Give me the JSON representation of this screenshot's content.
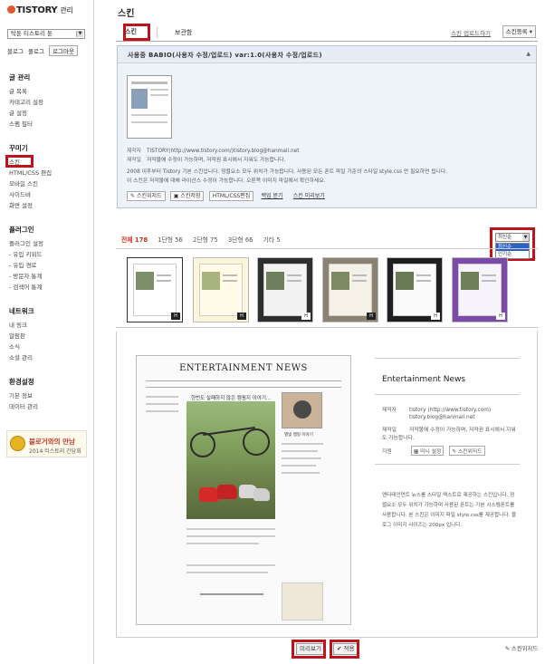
{
  "app": {
    "logo": "TISTORY",
    "admin": "관리"
  },
  "sidebar": {
    "blog_select": "탁툰 티스토리 툰",
    "top_links": [
      "블로그",
      "플로그",
      "로그아웃"
    ],
    "sections": [
      {
        "title": "글 관리",
        "items": [
          "글 목록",
          "카테고리 설정",
          "글 설정",
          "스팸 필터"
        ]
      },
      {
        "title": "꾸미기",
        "items": [
          "스킨",
          "HTML/CSS 편집",
          "모바일 스킨",
          "사이드바",
          "화면 설정"
        ]
      },
      {
        "title": "플러그인",
        "items": [
          "플러그인 설정",
          "- 유입 키워드",
          "- 유입 경로",
          "- 방문자 통계",
          "- 검색어 통계"
        ]
      },
      {
        "title": "네트워크",
        "items": [
          "내 링크",
          "알림판",
          "소식",
          "쇼셜 관리"
        ]
      },
      {
        "title": "환경설정",
        "items": [
          "기본 정보",
          "데이터 관리"
        ]
      }
    ],
    "banner": {
      "line1": "블로거와의 만남",
      "line2": "2014 티스토리 간담회"
    }
  },
  "main": {
    "title": "스킨",
    "tabs": {
      "active": "스킨",
      "other": "보관함",
      "right_link": "스킨 업로드하기",
      "register": "스킨등록"
    },
    "info": {
      "heading": "사용중  BABIO(사용자 수정/업로드) var:1.0(사용자 수정/업로드)",
      "rows": [
        {
          "label": "제작자",
          "value": "TISTORY(http://www.tistory.com/)tistory.blog@hanmail.net"
        },
        {
          "label": "제작일",
          "value": "저작물에 수정이 가능하며, 저작권 표시에서 지워도 가능합니다."
        }
      ],
      "desc1": "2008 이후부터 Tistory 기본 스킨입니다. 정렬요소 모두 위치가 가능합니다. 사용된 모든 폰트 파일 기준의 스타일 style.css 만 필요하면 됩니다.",
      "desc2": "이 스킨은 저작물에 대해 라이선스 수정이 가능합니다. 오른쪽 이미지 파일에서 확인하세요.",
      "buttons": [
        "스킨위저드",
        "스킨저장",
        "HTML/CSS편집",
        "백업 받기",
        "스킨 미리보기"
      ]
    },
    "filters": [
      {
        "label": "전체 178",
        "current": true
      },
      {
        "label": "1단형 56",
        "current": false
      },
      {
        "label": "2단형 75",
        "current": false
      },
      {
        "label": "3단형 66",
        "current": false
      },
      {
        "label": "기타 5",
        "current": false
      }
    ],
    "sort": {
      "selected": "최신순",
      "options": [
        "최신순",
        "인기순"
      ]
    },
    "preview": {
      "site_title": "ENTERTAINMENT NEWS",
      "headline": "한번도 실패하지 않은 캠핑지 이야기...",
      "photo_caption": "별빛 캠핑 이야기"
    },
    "detail": {
      "name": "Entertainment News",
      "rows": [
        {
          "label": "제작자",
          "value": "tistory (http://www.tistory.com)"
        },
        {
          "label": "",
          "value": "tistory.blog@hanmail.net"
        },
        {
          "label": "제작일",
          "value": "저작물에 수정이 가능하며, 저작권 표시에서 지워도 가능합니다."
        },
        {
          "label": "지원",
          "value": ""
        }
      ],
      "support_buttons": [
        "미니 설정",
        "스킨위저드"
      ],
      "description": "엔터테인먼트 뉴스를 스타일 텍스트로 제공하는 스킨입니다. 정렬요소 모두 위치가 가능하며 사용된 폰트는 기본 시스템폰트를 사용합니다. 본 스킨은 이미지 파일 style.css를 제공합니다. 블로그 이미지 사이즈는 200px 입니다."
    },
    "bottom": {
      "preview": "미리보기",
      "apply": "✔ 적용",
      "wizard": "스킨위저드"
    }
  },
  "colors": {
    "accent": "#d0321d",
    "highlight_box": "#c0121b",
    "info_bg": "#eef3fa"
  }
}
